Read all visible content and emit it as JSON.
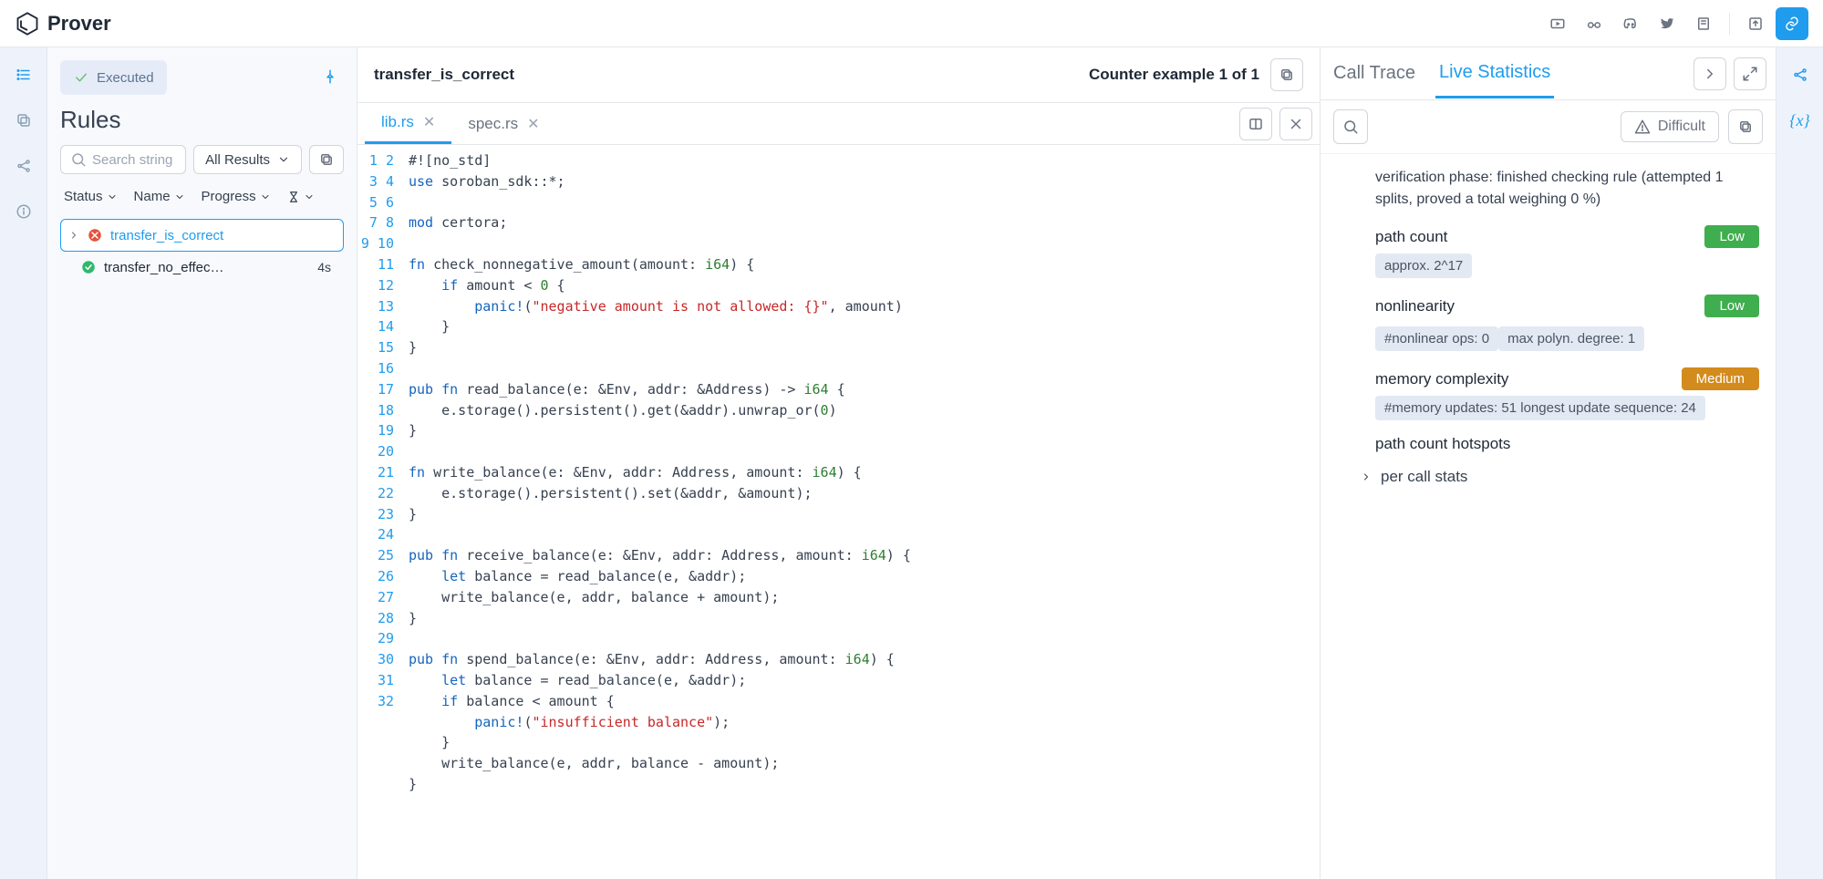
{
  "app": {
    "name": "Prover"
  },
  "topbar_icons": [
    "video-icon",
    "glasses-icon",
    "discord-icon",
    "twitter-icon",
    "book-icon",
    "export-icon",
    "link-icon"
  ],
  "leftrail_icons": [
    "list-icon",
    "copy-icon",
    "share-icon",
    "info-icon"
  ],
  "rules": {
    "exec_label": "Executed",
    "title": "Rules",
    "search_placeholder": "Search string",
    "filter_label": "All Results",
    "columns": {
      "status": "Status",
      "name": "Name",
      "progress": "Progress"
    },
    "items": [
      {
        "name": "transfer_is_correct",
        "status": "error",
        "selected": true,
        "time": ""
      },
      {
        "name": "transfer_no_effec…",
        "status": "ok",
        "selected": false,
        "time": "4s"
      }
    ]
  },
  "center": {
    "title": "transfer_is_correct",
    "counter": "Counter example 1 of 1",
    "tabs": [
      {
        "label": "lib.rs",
        "active": true
      },
      {
        "label": "spec.rs",
        "active": false
      }
    ],
    "code_lines": [
      "#![no_std]",
      "use soroban_sdk::*;",
      "",
      "mod certora;",
      "",
      "fn check_nonnegative_amount(amount: i64) {",
      "    if amount < 0 {",
      "        panic!(\"negative amount is not allowed: {}\", amount)",
      "    }",
      "}",
      "",
      "pub fn read_balance(e: &Env, addr: &Address) -> i64 {",
      "    e.storage().persistent().get(&addr).unwrap_or(0)",
      "}",
      "",
      "fn write_balance(e: &Env, addr: Address, amount: i64) {",
      "    e.storage().persistent().set(&addr, &amount);",
      "}",
      "",
      "pub fn receive_balance(e: &Env, addr: Address, amount: i64) {",
      "    let balance = read_balance(e, &addr);",
      "    write_balance(e, addr, balance + amount);",
      "}",
      "",
      "pub fn spend_balance(e: &Env, addr: Address, amount: i64) {",
      "    let balance = read_balance(e, &addr);",
      "    if balance < amount {",
      "        panic!(\"insufficient balance\");",
      "    }",
      "    write_balance(e, addr, balance - amount);",
      "}",
      ""
    ]
  },
  "right": {
    "tabs": {
      "call_trace": "Call Trace",
      "live_stats": "Live Statistics"
    },
    "difficult_label": "Difficult",
    "phase": "verification phase: finished checking rule (attempted 1 splits, proved a total weighing 0 %)",
    "stats": [
      {
        "label": "path count",
        "badge": "Low",
        "badge_cls": "low",
        "chips": [
          "approx. 2^17"
        ]
      },
      {
        "label": "nonlinearity",
        "badge": "Low",
        "badge_cls": "low",
        "chips": [
          "#nonlinear ops: 0",
          "max polyn. degree: 1"
        ]
      },
      {
        "label": "memory complexity",
        "badge": "Medium",
        "badge_cls": "medium",
        "chips": [
          "#memory updates: 51 longest update sequence: 24"
        ]
      }
    ],
    "hotspots": "path count hotspots",
    "per_call": "per call stats"
  }
}
